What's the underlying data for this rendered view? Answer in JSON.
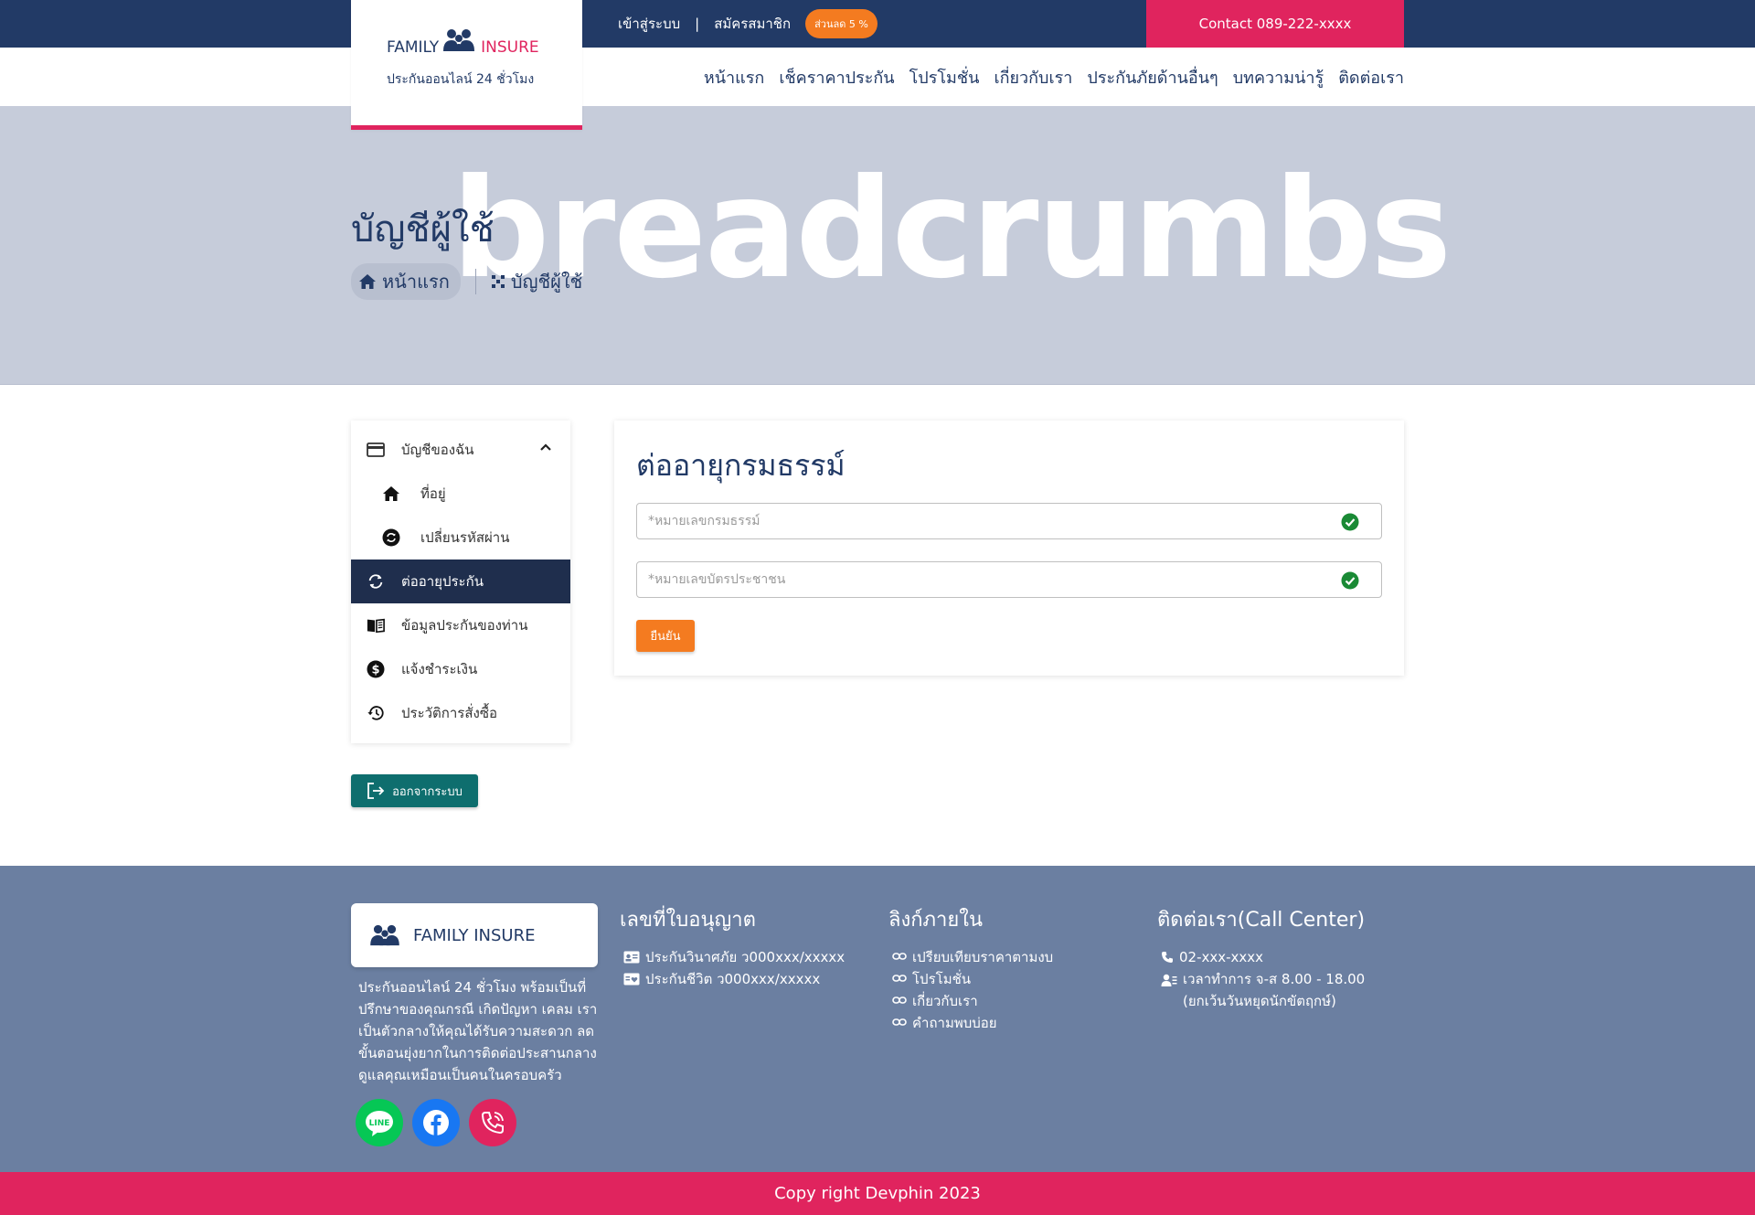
{
  "topbar": {
    "login": "เข้าสู่ระบบ",
    "separator": "|",
    "register": "สมัครสมาชิก",
    "discount": "ส่วนลด 5 %",
    "contact": "Contact 089-222-xxxx"
  },
  "logo": {
    "family": "FAMILY",
    "insure": "INSURE",
    "tagline": "ประกันออนไลน์ 24 ชั่วโมง"
  },
  "nav": {
    "items": [
      "หน้าแรก",
      "เช็คราคาประกัน",
      "โปรโมชั่น",
      "เกี่ยวกับเรา",
      "ประกันภัยด้านอื่นๆ",
      "บทความน่ารู้",
      "ติดต่อเรา"
    ]
  },
  "hero": {
    "watermark": "breadcrumbs",
    "title": "บัญชีผู้ใช้",
    "breadcrumb_home": "หน้าแรก",
    "breadcrumb_current": "บัญชีผู้ใช้"
  },
  "sidemenu": {
    "items": [
      {
        "label": "บัญชีของฉัน",
        "icon": "credit-card-icon"
      },
      {
        "label": "ที่อยู่",
        "icon": "home-icon"
      },
      {
        "label": "เปลี่ยนรหัสผ่าน",
        "icon": "sync-circle-icon"
      },
      {
        "label": "ต่ออายุประกัน",
        "icon": "refresh-icon"
      },
      {
        "label": "ข้อมูลประกันของท่าน",
        "icon": "book-icon"
      },
      {
        "label": "แจ้งชำระเงิน",
        "icon": "dollar-circle-icon"
      },
      {
        "label": "ประวัติการสั่งซื้อ",
        "icon": "history-icon"
      }
    ],
    "logout": "ออกจากระบบ"
  },
  "form": {
    "title": "ต่ออายุกรมธรรม์",
    "policy_placeholder": "*หมายเลขกรมธรรม์",
    "policy_value": "",
    "id_placeholder": "*หมายเลขบัตรประชาชน",
    "id_value": "",
    "submit": "ยืนยัน"
  },
  "footer": {
    "brand": "FAMILY INSURE",
    "about": "ประกันออนไลน์ 24 ชั่วโมง พร้อมเป็นที่ปรึกษาของคุณกรณี เกิดปัญหา เคลม เราเป็นตัวกลางให้คุณได้รับความสะดวก ลดขั้นตอนยุ่งยากในการติดต่อประสานกลาง ดูแลคุณเหมือนเป็นคนในครอบครัว",
    "license": {
      "title": "เลขที่ใบอนุญาต",
      "items": [
        "ประกันวินาศภัย ว000xxx/xxxxx",
        "ประกันชีวิต ว000xxx/xxxxx"
      ]
    },
    "links": {
      "title": "ลิงก์ภายใน",
      "items": [
        "เปรียบเทียบราคาตามงบ",
        "โปรโมชั่น",
        "เกี่ยวกับเรา",
        "คำถามพบบ่อย"
      ]
    },
    "contact": {
      "title": "ติดต่อเรา(Call Center)",
      "phone": "02-xxx-xxxx",
      "hours": "เวลาทำการ จ-ส 8.00 - 18.00",
      "hours_note": "(ยกเว้นวันหยุดนักขัตฤกษ์)"
    },
    "social": {
      "line_label": "LINE",
      "line_color": "#06c755",
      "facebook_color": "#1877f2",
      "phone_color": "#e0245e"
    },
    "copyright": "Copy right Devphin 2023"
  },
  "colors": {
    "primary_navy": "#223a66",
    "accent_pink": "#e0245e",
    "accent_orange": "#f47b20",
    "footer_bg": "#6b7fa1",
    "active_menu": "#1f2e4d",
    "logout_teal": "#0e6e6e"
  }
}
